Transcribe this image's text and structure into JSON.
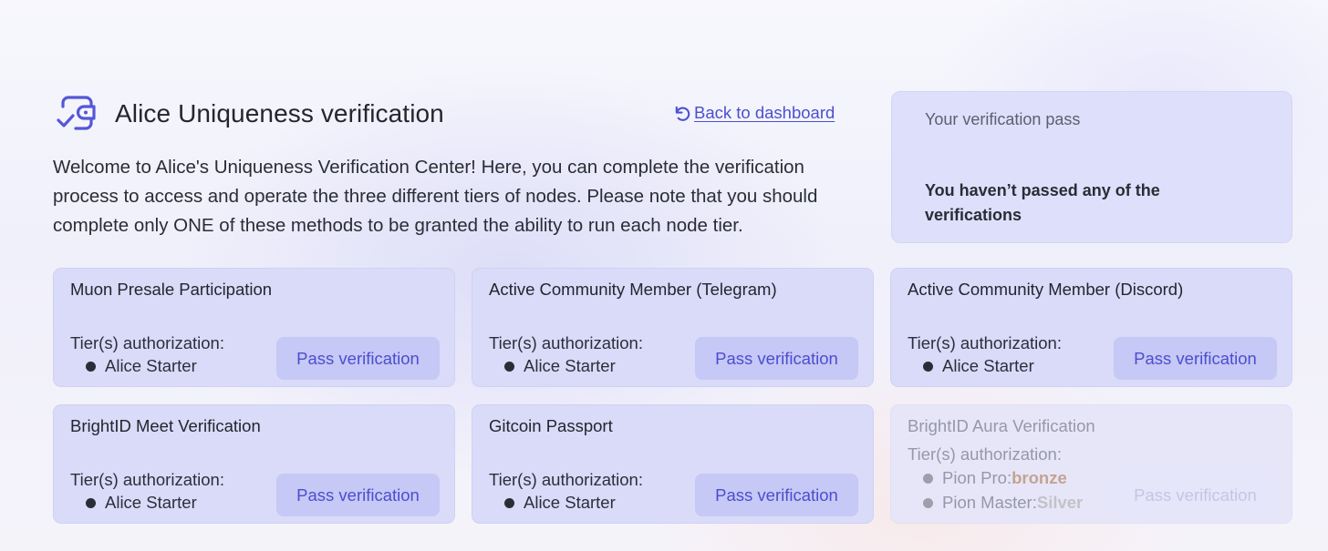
{
  "header": {
    "title": "Alice Uniqueness verification",
    "back_label": "Back to dashboard",
    "logo_icon": "wallet-check-icon",
    "back_icon": "undo-arrow-icon"
  },
  "intro": "Welcome to Alice's Uniqueness Verification Center! Here, you can complete the verification process to access and operate the three different tiers of nodes. Please note that you should complete only ONE of these methods to be granted the ability to run each node tier.",
  "pass_panel": {
    "title": "Your verification pass",
    "status": "You haven’t passed any of the verifications"
  },
  "colors": {
    "accent": "#4c4fd0",
    "card_bg": "#d9dbf9",
    "button_bg": "#c6c8f5",
    "bronze": "#c3a48f",
    "silver": "#c2c2c8"
  },
  "cards": [
    {
      "title": "Muon Presale Participation",
      "tier_label": "Tier(s) authorization:",
      "tiers": [
        "Alice Starter"
      ],
      "button": "Pass verification"
    },
    {
      "title": "Active Community Member (Telegram)",
      "tier_label": "Tier(s) authorization:",
      "tiers": [
        "Alice Starter"
      ],
      "button": "Pass verification"
    },
    {
      "title": "Active Community Member (Discord)",
      "tier_label": "Tier(s) authorization:",
      "tiers": [
        "Alice Starter"
      ],
      "button": "Pass verification"
    },
    {
      "title": "BrightID Meet Verification",
      "tier_label": "Tier(s) authorization:",
      "tiers": [
        "Alice Starter"
      ],
      "button": "Pass verification"
    },
    {
      "title": "Gitcoin Passport",
      "tier_label": "Tier(s) authorization:",
      "tiers": [
        "Alice Starter"
      ],
      "button": "Pass verification"
    },
    {
      "title": "BrightID Aura Verification",
      "tier_label": "Tier(s) authorization:",
      "tiers_detail": [
        {
          "name": "Pion Pro:",
          "value": "bronze"
        },
        {
          "name": "Pion Master:",
          "value": "Silver"
        }
      ],
      "button": "Pass verification",
      "disabled": true
    }
  ]
}
